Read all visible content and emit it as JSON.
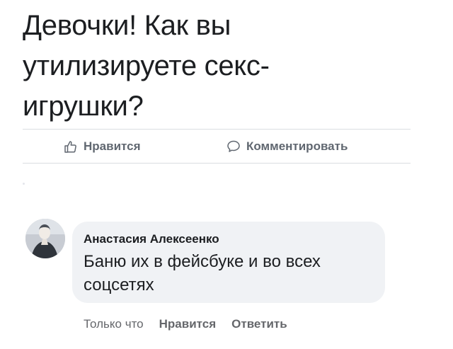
{
  "post": {
    "text_lines": [
      "Девочки! Как вы",
      "утилизируете секс-",
      "игрушки?"
    ]
  },
  "actions": {
    "like_label": "Нравится",
    "like_icon": "thumbs-up-icon",
    "comment_label": "Комментировать",
    "comment_icon": "speech-bubble-icon"
  },
  "comment": {
    "author": "Анастасия Алексеенко",
    "text_lines": [
      "Баню их в фейсбуке и во всех",
      "соцсетях"
    ],
    "time": "Только что",
    "like_label": "Нравится",
    "reply_label": "Ответить"
  },
  "colors": {
    "text": "#1c1e21",
    "secondary": "#606770",
    "bubble": "#f0f2f5",
    "divider": "#dadde1"
  }
}
